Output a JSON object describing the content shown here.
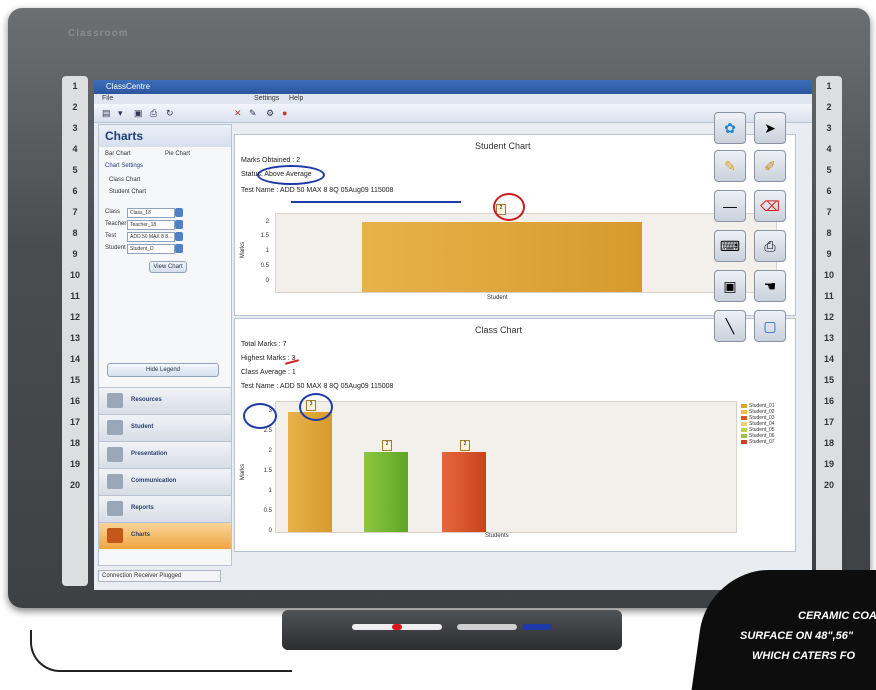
{
  "board": {
    "brand": "Classroom",
    "rail_numbers_left": [
      "1",
      "2",
      "3",
      "4",
      "5",
      "6",
      "7",
      "8",
      "9",
      "10",
      "11",
      "12",
      "13",
      "14",
      "15",
      "16",
      "17",
      "18",
      "19",
      "20"
    ],
    "rail_numbers_right": [
      "1",
      "2",
      "3",
      "4",
      "5",
      "6",
      "7",
      "8",
      "9",
      "10",
      "11",
      "12",
      "13",
      "14",
      "15",
      "16",
      "17",
      "18",
      "19",
      "20"
    ]
  },
  "app": {
    "title": "ClassCentre",
    "menu": [
      "File",
      "Settings",
      "Help"
    ],
    "status_bar": "Connection Receiver Plugged"
  },
  "sidebar": {
    "title": "Charts",
    "chart_types": [
      "Bar Chart",
      "Pie Chart"
    ],
    "settings_label": "Chart Settings",
    "chart_options": [
      "Class Chart",
      "Student Chart"
    ],
    "fields": [
      {
        "label": "Class",
        "value": "Class_18"
      },
      {
        "label": "Teacher",
        "value": "Teacher_18"
      },
      {
        "label": "Test",
        "value": "ADD 50 MAX 8 8..."
      },
      {
        "label": "Student",
        "value": "Student_D"
      }
    ],
    "view_button": "View Chart",
    "legend_button": "Hide Legend",
    "nav": [
      "Resources",
      "Student",
      "Presentation",
      "Communication",
      "Reports",
      "Charts"
    ]
  },
  "student_chart": {
    "title": "Student Chart",
    "marks_obtained": "Marks Obtained : 2",
    "status": "Status: Above Average",
    "test_name": "Test Name : ADD 50 MAX 8 8Q 05Aug09 115008",
    "xlabel": "Student",
    "ylabel": "Marks",
    "bar_label": "2"
  },
  "class_chart": {
    "title": "Class Chart",
    "total_marks": "Total Marks : 7",
    "highest_marks": "Highest Marks : 3",
    "class_average": "Class Average : 1",
    "test_name": "Test Name : ADD 50 MAX 8 8Q 05Aug09 115008",
    "xlabel": "Students",
    "ylabel": "Marks",
    "bar_labels": [
      "3",
      "2",
      "2"
    ],
    "legend": [
      "Student_01",
      "Student_02",
      "Student_03",
      "Student_04",
      "Student_05",
      "Student_06",
      "Student_07"
    ]
  },
  "chart_data": [
    {
      "type": "bar",
      "title": "Student Chart",
      "xlabel": "Student",
      "ylabel": "Marks",
      "categories": [
        ""
      ],
      "values": [
        2
      ],
      "ylim": [
        0,
        2
      ],
      "yticks": [
        "0",
        "0.5",
        "1",
        "1.5",
        "2"
      ]
    },
    {
      "type": "bar",
      "title": "Class Chart",
      "xlabel": "Students",
      "ylabel": "Marks",
      "categories": [
        "",
        "",
        ""
      ],
      "values": [
        3,
        2,
        2
      ],
      "ylim": [
        0,
        3
      ],
      "yticks": [
        "0",
        "0.5",
        "1",
        "1.5",
        "2",
        "2.5",
        "3"
      ],
      "colors": [
        "#e0a53a",
        "#76b833",
        "#d9552c"
      ]
    }
  ],
  "banner": {
    "line1": "CERAMIC COA",
    "line2": "SURFACE ON 48\",56\"",
    "line3": "WHICH CATERS FO"
  },
  "colors": {
    "annotation_blue": "#1c3aa8",
    "annotation_red": "#d11a1a",
    "bar_gold": "#e0a53a"
  }
}
